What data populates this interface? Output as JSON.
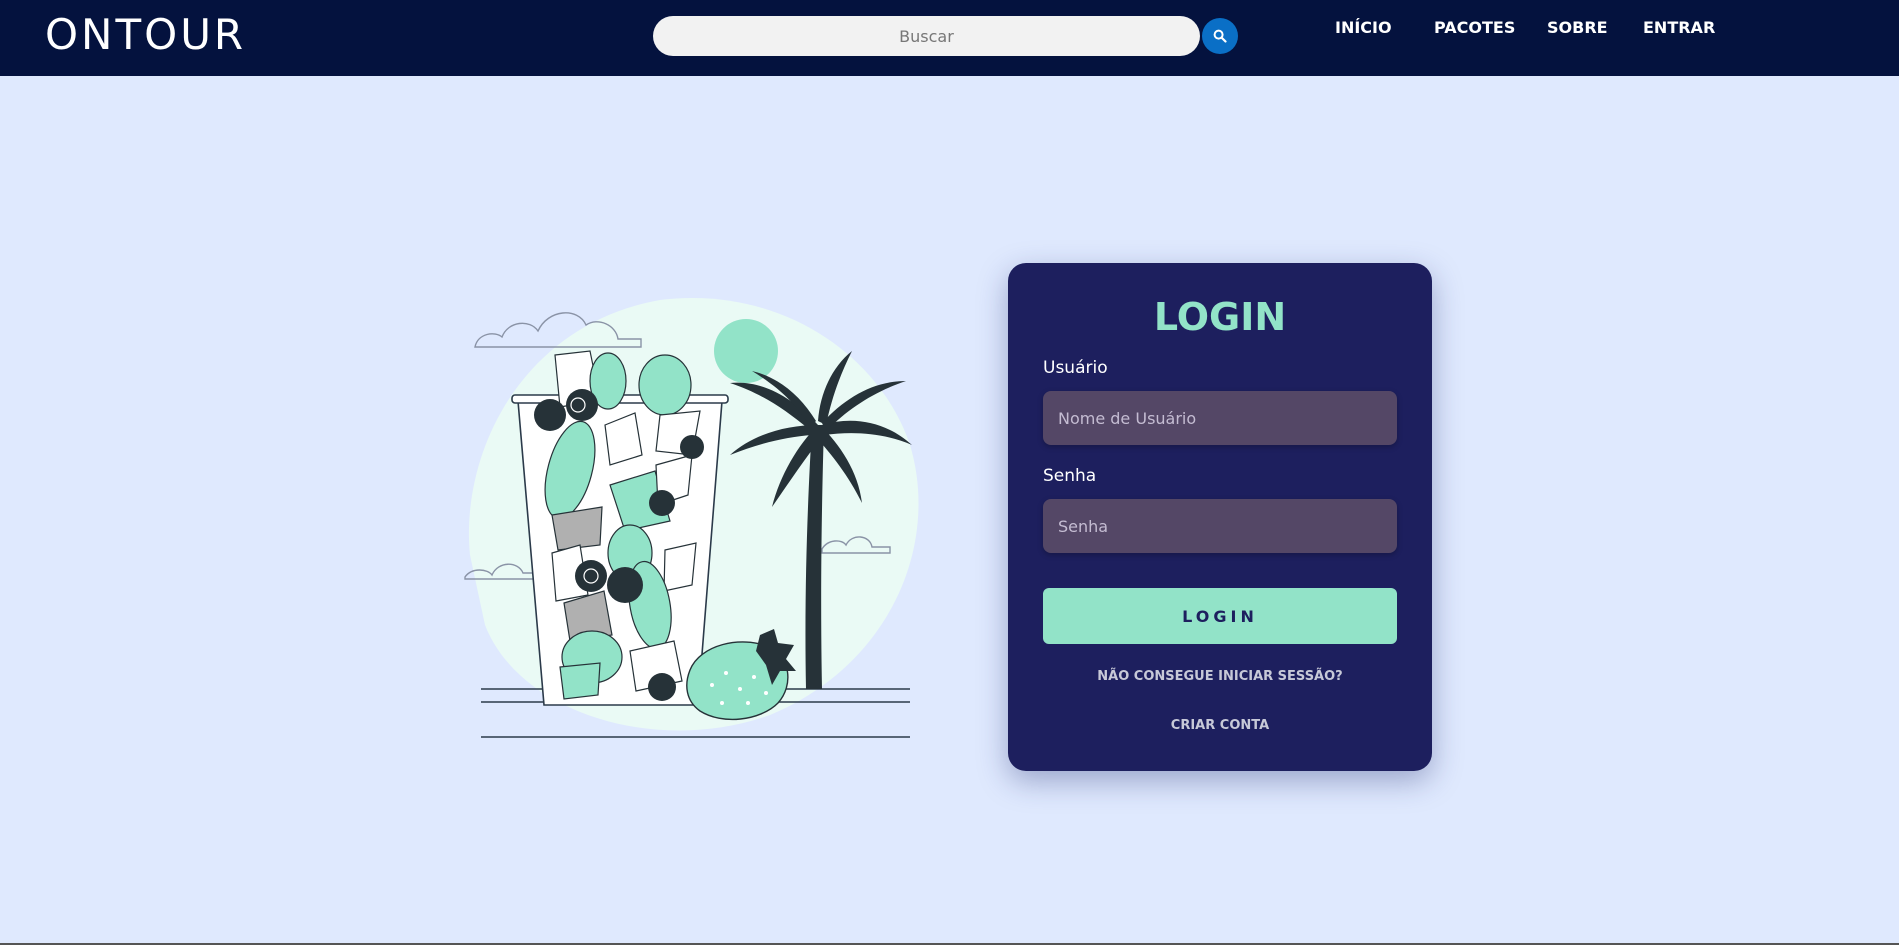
{
  "header": {
    "brand": "ONTOUR",
    "search": {
      "placeholder": "Buscar"
    },
    "nav": [
      {
        "label": "INÍCIO"
      },
      {
        "label": "PACOTES"
      },
      {
        "label": "SOBRE"
      },
      {
        "label": "ENTRAR"
      }
    ]
  },
  "login": {
    "title": "LOGIN",
    "username_label": "Usuário",
    "username_placeholder": "Nome de Usuário",
    "password_label": "Senha",
    "password_placeholder": "Senha",
    "submit_label": "LOGIN",
    "forgot_label": "NÃO CONSEGUE INICIAR SESSÃO?",
    "signup_label": "CRIAR CONTA"
  },
  "colors": {
    "navbar_bg": "#04123e",
    "page_bg": "#dfe9fe",
    "card_bg": "#1d1f5e",
    "accent": "#92e3c8",
    "input_bg": "#544766",
    "search_button": "#0a6fc6"
  },
  "icons": {
    "search_button": "search-icon"
  }
}
